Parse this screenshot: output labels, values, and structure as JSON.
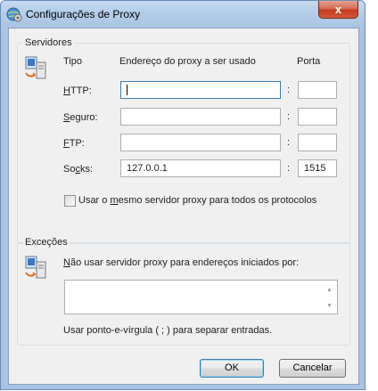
{
  "window": {
    "title": "Configurações de Proxy",
    "close_label": "x"
  },
  "servers": {
    "group_label": "Servidores",
    "col_type": "Tipo",
    "col_address": "Endereço do proxy a ser usado",
    "col_port": "Porta",
    "rows": [
      {
        "label_ul": "H",
        "label_rest": "TTP:",
        "address": "",
        "port": ""
      },
      {
        "label_ul": "S",
        "label_rest": "eguro:",
        "address": "",
        "port": ""
      },
      {
        "label_ul": "F",
        "label_rest": "TP:",
        "address": "",
        "port": ""
      },
      {
        "label_pre": "So",
        "label_ul": "c",
        "label_rest": "ks:",
        "address": "127.0.0.1",
        "port": "1515"
      }
    ],
    "colon": ":",
    "same_server": {
      "pre": "Usar o ",
      "ul": "m",
      "rest": "esmo servidor proxy para todos os protocolos",
      "checked": false
    }
  },
  "exceptions": {
    "group_label": "Exceções",
    "desc_ul": "N",
    "desc_rest": "ão usar servidor proxy para endereços iniciados por:",
    "value": "",
    "hint": "Usar ponto-e-vírgula ( ; ) para separar entradas."
  },
  "buttons": {
    "ok": "OK",
    "cancel": "Cancelar"
  }
}
